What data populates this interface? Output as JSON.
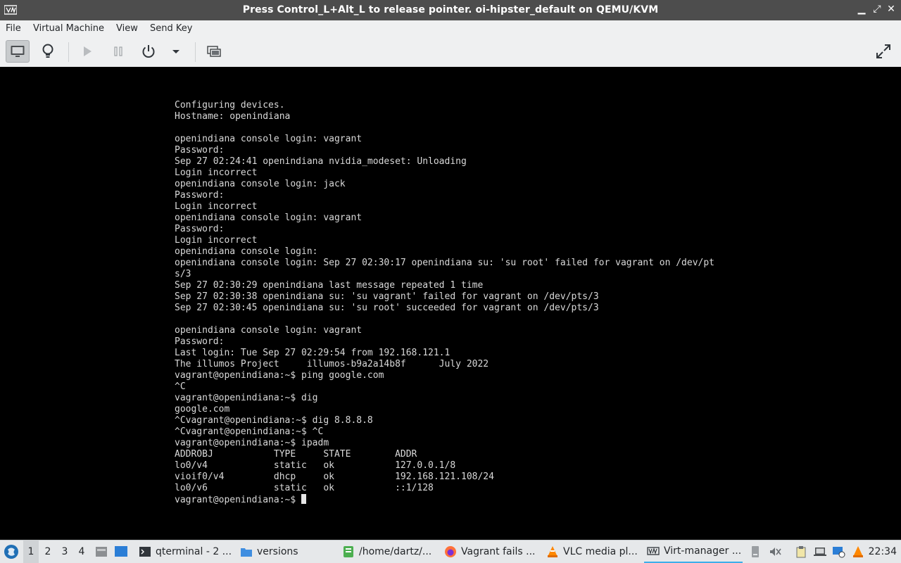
{
  "window": {
    "title": "Press Control_L+Alt_L to release pointer. oi-hipster_default on QEMU/KVM"
  },
  "menu": {
    "items": [
      "File",
      "Virtual Machine",
      "View",
      "Send Key"
    ]
  },
  "toolbar": {
    "icons": [
      "monitor-icon",
      "lightbulb-icon",
      "play-icon",
      "pause-icon",
      "power-icon",
      "dropdown-arrow-icon",
      "snapshot-icon",
      "fullscreen-icon"
    ]
  },
  "console": {
    "lines": [
      "Configuring devices.",
      "Hostname: openindiana",
      "",
      "openindiana console login: vagrant",
      "Password:",
      "Sep 27 02:24:41 openindiana nvidia_modeset: Unloading",
      "Login incorrect",
      "openindiana console login: jack",
      "Password:",
      "Login incorrect",
      "openindiana console login: vagrant",
      "Password:",
      "Login incorrect",
      "openindiana console login:",
      "openindiana console login: Sep 27 02:30:17 openindiana su: 'su root' failed for vagrant on /dev/pt",
      "s/3",
      "Sep 27 02:30:29 openindiana last message repeated 1 time",
      "Sep 27 02:30:38 openindiana su: 'su vagrant' failed for vagrant on /dev/pts/3",
      "Sep 27 02:30:45 openindiana su: 'su root' succeeded for vagrant on /dev/pts/3",
      "",
      "openindiana console login: vagrant",
      "Password:",
      "Last login: Tue Sep 27 02:29:54 from 192.168.121.1",
      "The illumos Project     illumos-b9a2a14b8f      July 2022",
      "vagrant@openindiana:~$ ping google.com",
      "^C",
      "vagrant@openindiana:~$ dig",
      "google.com",
      "^Cvagrant@openindiana:~$ dig 8.8.8.8",
      "^Cvagrant@openindiana:~$ ^C",
      "vagrant@openindiana:~$ ipadm",
      "ADDROBJ           TYPE     STATE        ADDR",
      "lo0/v4            static   ok           127.0.0.1/8",
      "vioif0/v4         dhcp     ok           192.168.121.108/24",
      "lo0/v6            static   ok           ::1/128",
      "vagrant@openindiana:~$ "
    ]
  },
  "taskbar": {
    "desktops": [
      "1",
      "2",
      "3",
      "4"
    ],
    "active_desktop": "1",
    "tasks": [
      {
        "label": "qterminal - 2 ...",
        "icon": "terminal-icon"
      },
      {
        "label": "versions",
        "icon": "folder-icon"
      },
      {
        "label": "/home/dartz/...",
        "icon": "text-editor-icon"
      },
      {
        "label": "Vagrant fails ...",
        "icon": "firefox-icon"
      },
      {
        "label": "VLC media pl...",
        "icon": "vlc-icon"
      },
      {
        "label": "Virt-manager ...",
        "icon": "virt-manager-icon"
      }
    ],
    "tray_icons": [
      "removable-drive-icon",
      "volume-muted-icon",
      "clipboard-icon",
      "laptop-icon",
      "network-icon",
      "vlc-tray-icon"
    ],
    "clock": "22:34"
  },
  "colors": {
    "titlebar": "#4d4d4d",
    "console_bg": "#000000",
    "console_fg": "#d9d9d9",
    "accent": "#3daee9"
  }
}
